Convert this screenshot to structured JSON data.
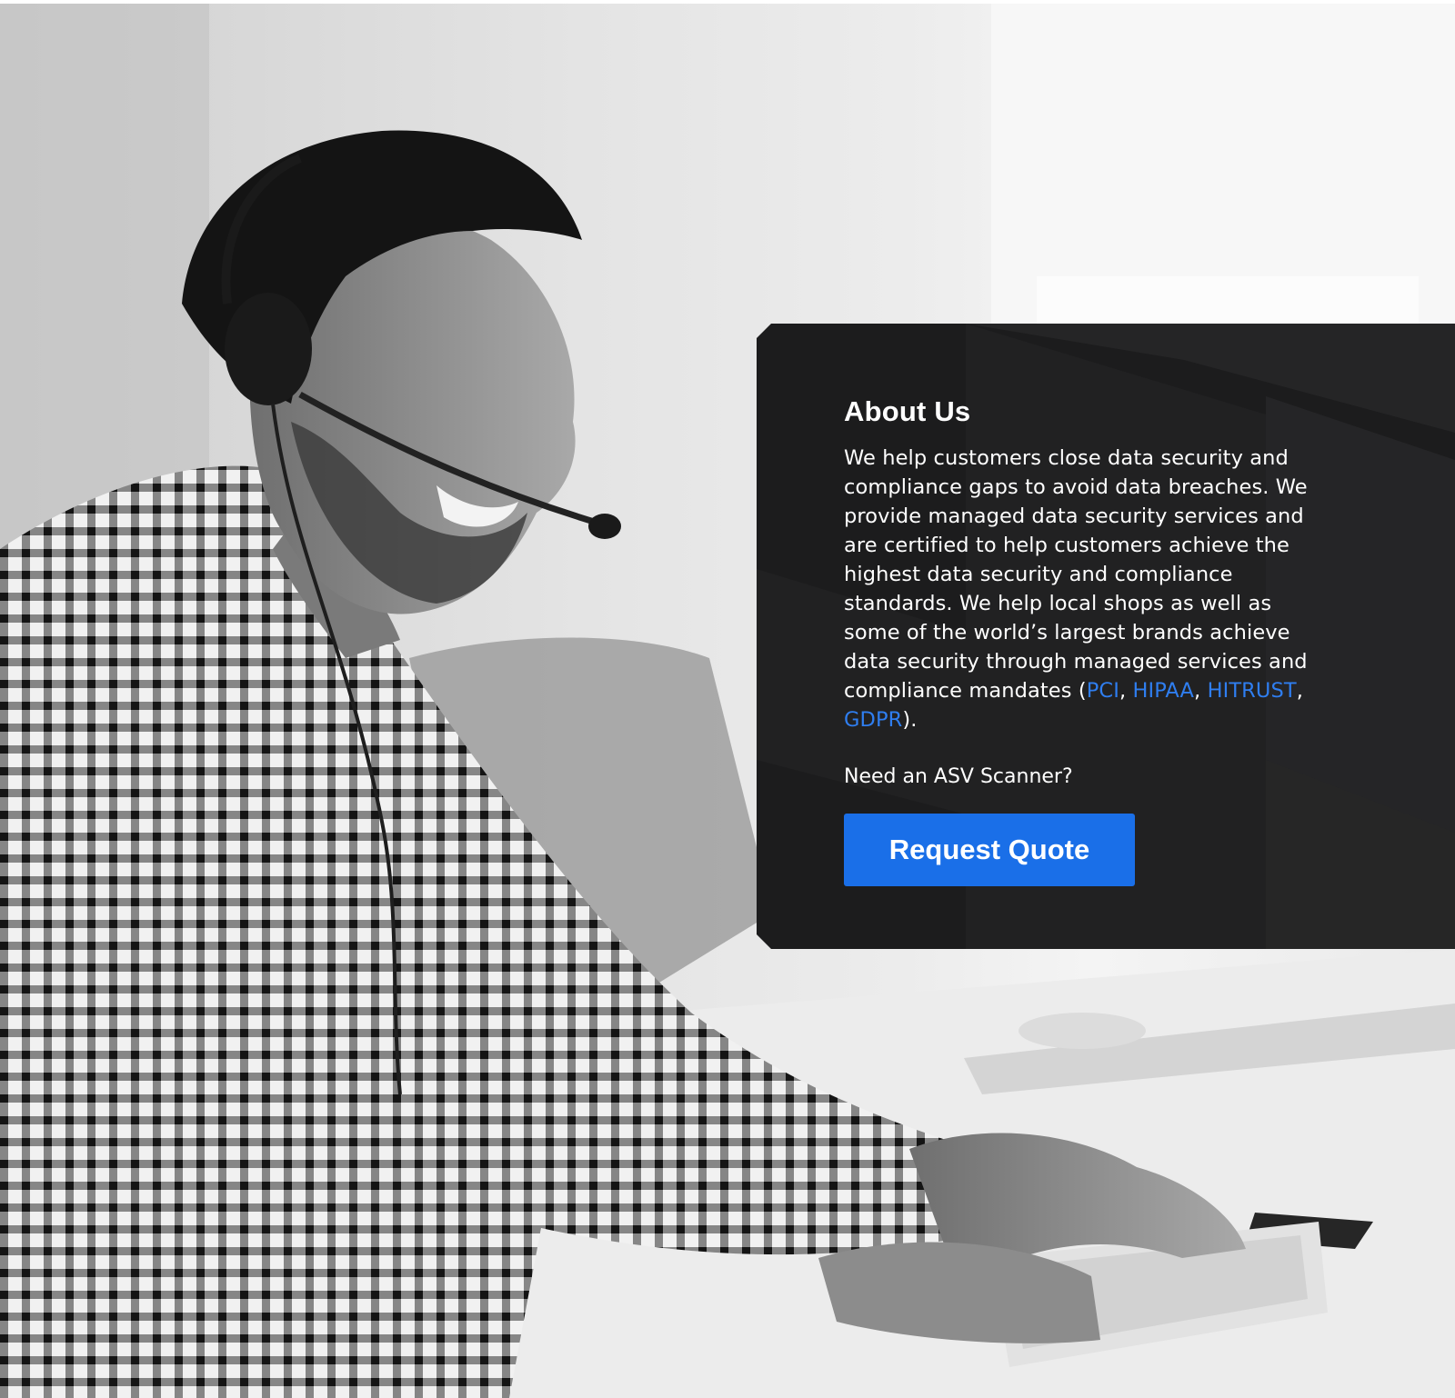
{
  "about": {
    "title": "About Us",
    "body_lead": "We help customers close data security and compliance gaps to avoid data breaches. We provide managed data security services and are certified to help customers achieve the highest data security and compliance standards. We help local shops as well as some of the world’s largest brands achieve data security through managed services and compliance mandates (",
    "standards": [
      "PCI",
      "HIPAA",
      "HITRUST",
      "GDPR"
    ],
    "separator": ", ",
    "body_tail": ").",
    "asv_question": "Need an ASV Scanner?",
    "cta_label": "Request Quote"
  },
  "colors": {
    "card_background": "#1c1c1d",
    "link": "#2f7ef0",
    "cta_background": "#1a6fe8",
    "text": "#ffffff"
  },
  "hero_image": {
    "alt": "Smiling man wearing a headset typing on a keyboard"
  }
}
